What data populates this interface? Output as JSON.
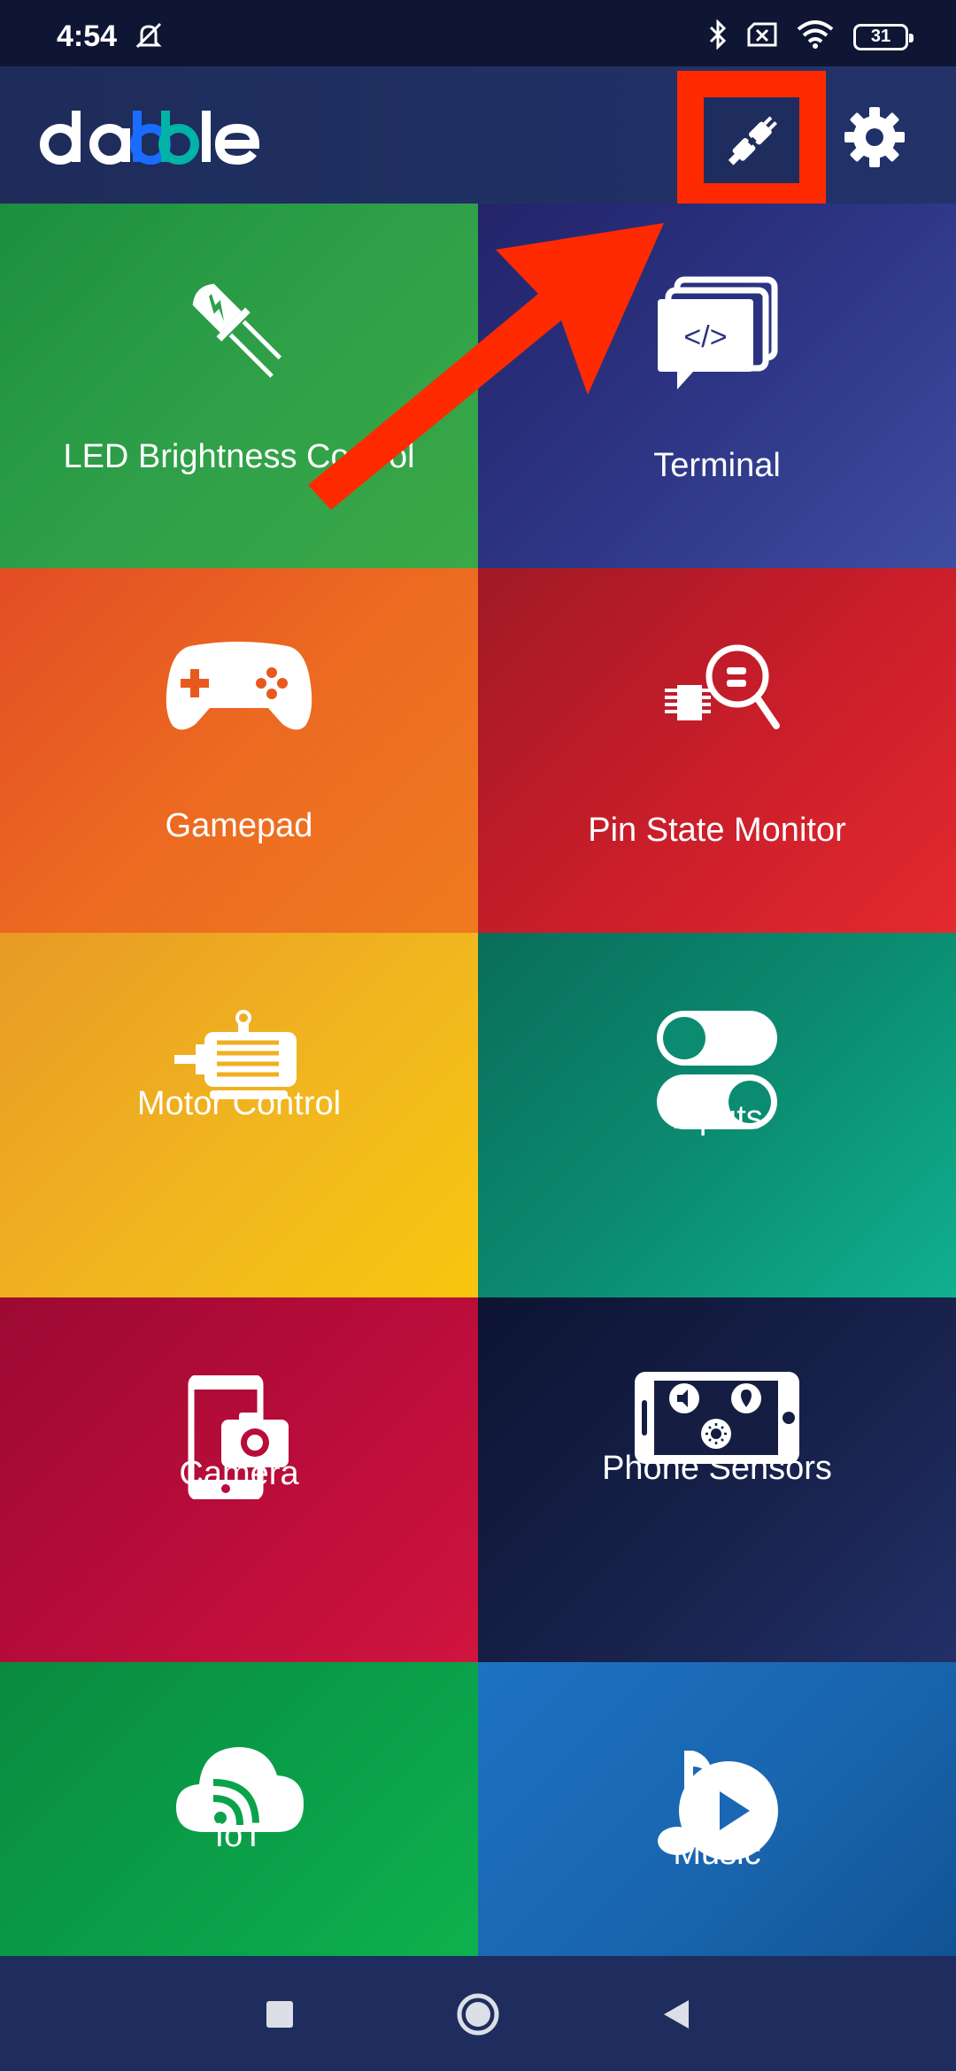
{
  "status": {
    "time": "4:54",
    "battery": "31"
  },
  "header": {
    "logo_text": "dabble",
    "connect_icon": "plug-connect-icon",
    "settings_icon": "gear-icon"
  },
  "tiles": [
    {
      "label": "LED Brightness Control",
      "icon": "led-icon"
    },
    {
      "label": "Terminal",
      "icon": "terminal-icon"
    },
    {
      "label": "Gamepad",
      "icon": "gamepad-icon"
    },
    {
      "label": "Pin State Monitor",
      "icon": "pin-monitor-icon"
    },
    {
      "label": "Motor Control",
      "icon": "motor-icon"
    },
    {
      "label": "Inputs",
      "icon": "toggle-switches-icon"
    },
    {
      "label": "Camera",
      "icon": "camera-icon"
    },
    {
      "label": "Phone Sensors",
      "icon": "phone-sensors-icon"
    },
    {
      "label": "IoT",
      "icon": "cloud-wifi-icon"
    },
    {
      "label": "Music",
      "icon": "music-icon"
    }
  ],
  "colors": {
    "annotation": "#ff2a00",
    "header_bg": "#1f2d5e"
  }
}
